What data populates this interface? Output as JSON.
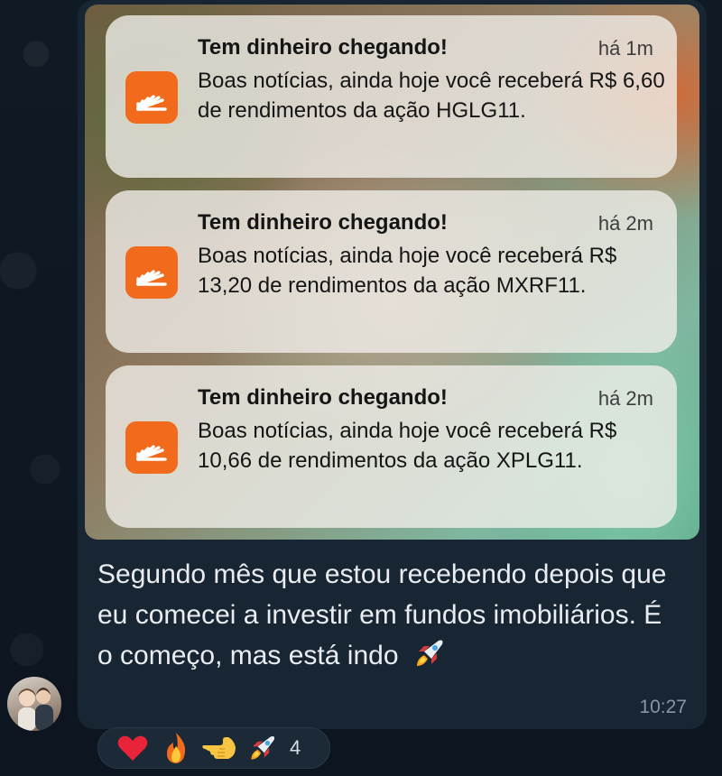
{
  "notifications": [
    {
      "title": "Tem dinheiro chegando!",
      "time": "há 1m",
      "body": "Boas notícias, ainda hoje você receberá R$ 6,60 de rendimentos da ação HGLG11."
    },
    {
      "title": "Tem dinheiro chegando!",
      "time": "há 2m",
      "body": "Boas notícias, ainda hoje você receberá R$ 13,20 de rendimentos da ação MXRF11."
    },
    {
      "title": "Tem dinheiro chegando!",
      "time": "há 2m",
      "body": "Boas notícias, ainda hoje você receberá R$ 10,66 de rendimentos da ação XPLG11."
    }
  ],
  "message": {
    "text": "Segundo mês que estou recebendo depois que eu comecei a investir em fundos imobiliários. É o começo, mas está indo",
    "emoji": "rocket-icon",
    "time": "10:27"
  },
  "reactions": {
    "items": [
      "heart-icon",
      "fire-icon",
      "pointing-hand-icon",
      "rocket-icon"
    ],
    "count": "4"
  },
  "colors": {
    "chat_background": "#0e1621",
    "bubble": "#182533",
    "app_icon": "#f26b1d",
    "time_text": "#8796a5"
  }
}
